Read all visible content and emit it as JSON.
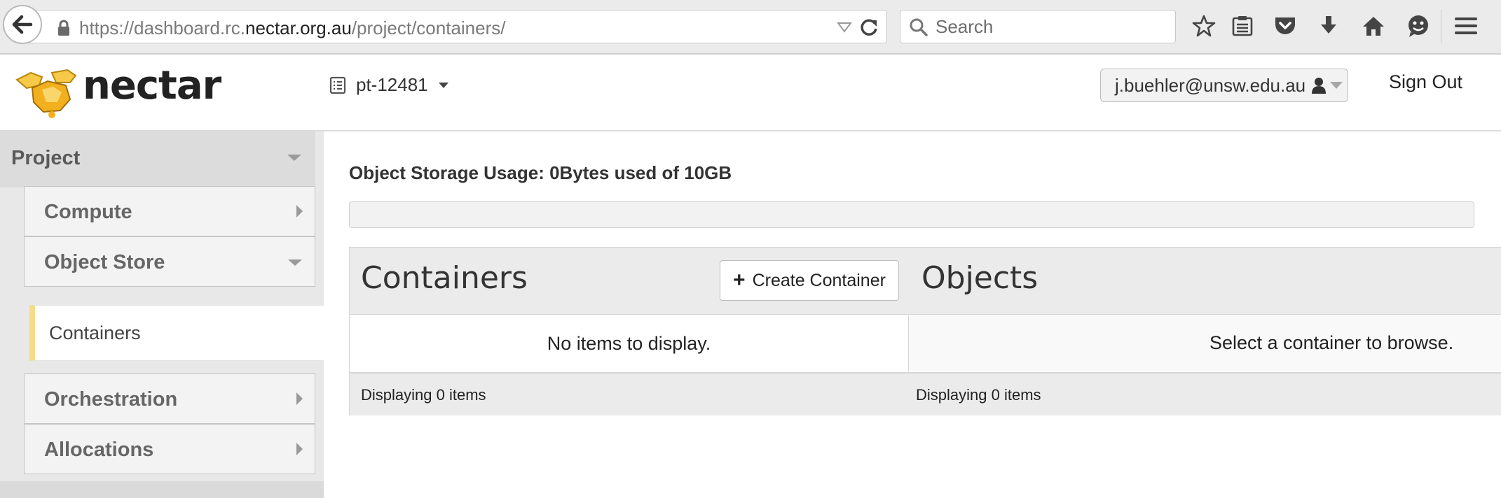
{
  "browser": {
    "url_prefix": "https://dashboard.rc.",
    "url_domain": "nectar.org.au",
    "url_path": "/project/containers/",
    "search_placeholder": "Search",
    "toolbar_icons": [
      "star-icon",
      "reading-list-icon",
      "pocket-icon",
      "download-icon",
      "home-icon",
      "chat-icon",
      "menu-icon"
    ]
  },
  "header": {
    "logo_text": "nectar",
    "project": "pt-12481",
    "user": "j.buehler@unsw.edu.au",
    "sign_out": "Sign Out"
  },
  "sidebar": {
    "project_label": "Project",
    "items": [
      {
        "label": "Compute"
      },
      {
        "label": "Object Store"
      },
      {
        "label": "Containers"
      },
      {
        "label": "Orchestration"
      },
      {
        "label": "Allocations"
      }
    ]
  },
  "main": {
    "usage_title": "Object Storage Usage: 0Bytes used of 10GB",
    "usage_fraction": 0,
    "containers_title": "Containers",
    "create_button": "Create Container",
    "objects_title": "Objects",
    "containers_empty": "No items to display.",
    "objects_empty": "Select a container to browse.",
    "containers_footer": "Displaying 0 items",
    "objects_footer": "Displaying 0 items"
  },
  "colors": {
    "active_accent": "#f5dc8a",
    "logo_yellow": "#f2b01e"
  }
}
